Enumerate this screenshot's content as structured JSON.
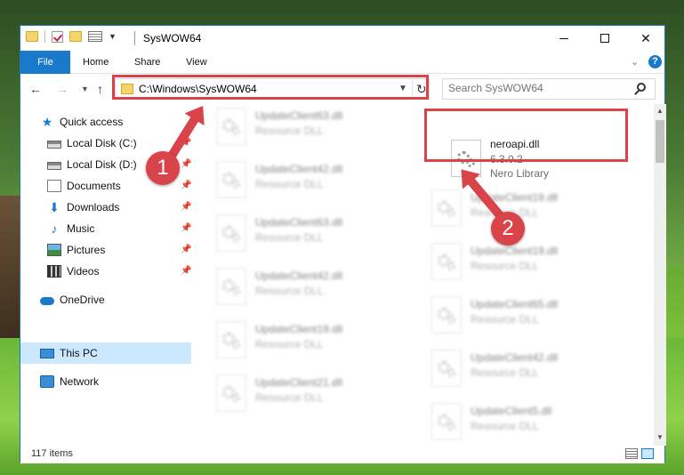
{
  "window": {
    "title": "SysWOW64",
    "close_glyph": "✕"
  },
  "ribbon": {
    "tabs": [
      "File",
      "Home",
      "Share",
      "View"
    ],
    "help_label": "?"
  },
  "navbar": {
    "address": "C:\\Windows\\SysWOW64",
    "search_placeholder": "Search SysWOW64"
  },
  "sidebar": {
    "items": [
      {
        "label": "Quick access",
        "icon": "star-icon"
      },
      {
        "label": "Local Disk (C:)",
        "icon": "drive-icon",
        "pinned": true
      },
      {
        "label": "Local Disk (D:)",
        "icon": "drive-icon",
        "pinned": true
      },
      {
        "label": "Documents",
        "icon": "documents-icon",
        "pinned": true
      },
      {
        "label": "Downloads",
        "icon": "download-icon",
        "pinned": true
      },
      {
        "label": "Music",
        "icon": "music-icon",
        "pinned": true
      },
      {
        "label": "Pictures",
        "icon": "pictures-icon",
        "pinned": true
      },
      {
        "label": "Videos",
        "icon": "videos-icon",
        "pinned": true
      },
      {
        "label": "OneDrive",
        "icon": "onedrive-icon"
      },
      {
        "label": "This PC",
        "icon": "computer-icon",
        "selected": true
      },
      {
        "label": "Network",
        "icon": "network-icon"
      }
    ]
  },
  "files": {
    "left_column": [
      {
        "name": "UpdateClient63.dll",
        "type": "Resource DLL"
      },
      {
        "name": "UpdateClient42.dll",
        "type": "Resource DLL"
      },
      {
        "name": "UpdateClient63.dll",
        "type": "Resource DLL"
      },
      {
        "name": "UpdateClient42.dll",
        "type": "Resource DLL"
      },
      {
        "name": "UpdateClient19.dll",
        "type": "Resource DLL"
      },
      {
        "name": "UpdateClient21.dll",
        "type": "Resource DLL"
      }
    ],
    "right_column": [
      {
        "name": "UpdateClient19.dll",
        "type": "Resource DLL"
      },
      {
        "name": "UpdateClient19.dll",
        "type": "Resource DLL"
      },
      {
        "name": "UpdateClient65.dll",
        "type": "Resource DLL"
      },
      {
        "name": "UpdateClient42.dll",
        "type": "Resource DLL"
      },
      {
        "name": "UpdateClient5.dll",
        "type": "Resource DLL"
      }
    ],
    "highlighted": {
      "name": "neroapi.dll",
      "version": "6.3.0.2",
      "description": "Nero Library"
    }
  },
  "status": {
    "item_count": "117 items"
  },
  "callouts": [
    "1",
    "2"
  ],
  "colors": {
    "accent": "#1979ca",
    "highlight": "#d9434a",
    "selected": "#cce8ff"
  }
}
